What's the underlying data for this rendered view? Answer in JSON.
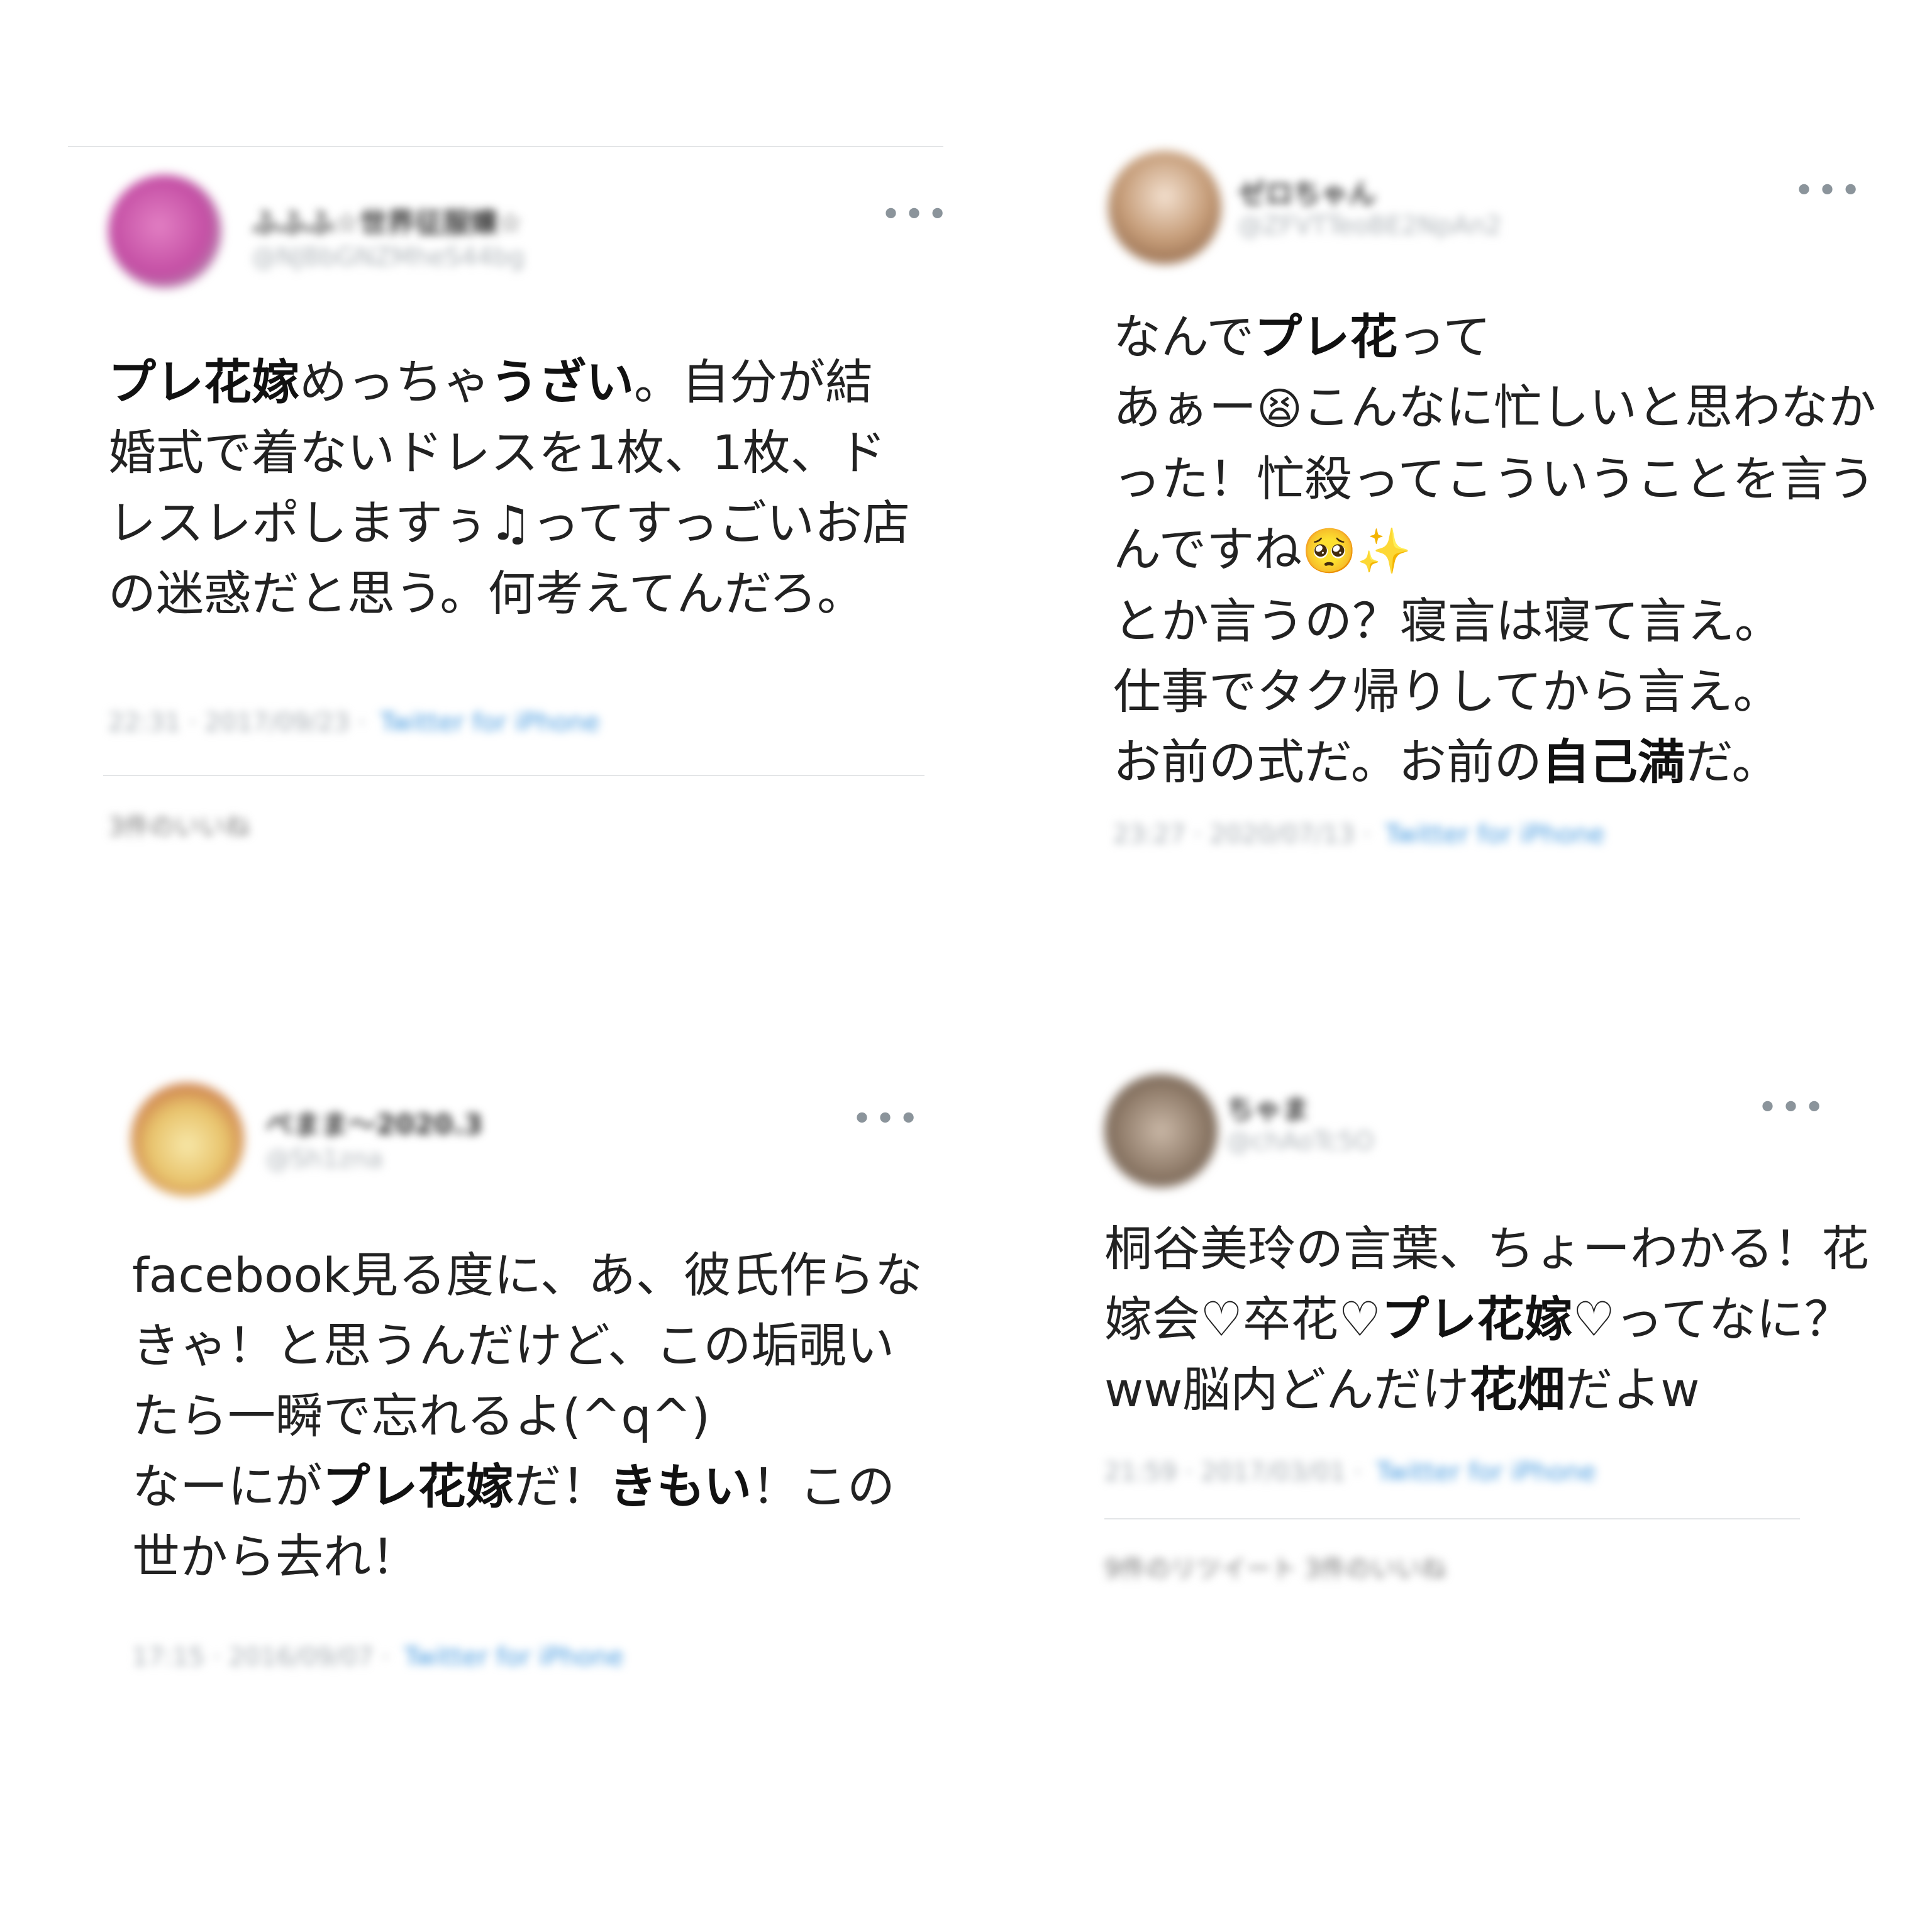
{
  "tweets": [
    {
      "name": "ふふふ☆世界征服嬢☆",
      "handle": "@NJBbGNZMheS44bg",
      "lines": [
        [
          {
            "t": "プレ花嫁",
            "b": true
          },
          {
            "t": "めっちゃ"
          },
          {
            "t": "うざい",
            "b": true
          },
          {
            "t": "。自分が結"
          }
        ],
        [
          {
            "t": "婚式で着ないドレスを1枚、1枚、ド"
          }
        ],
        [
          {
            "t": "レスレポしますぅ♫ってすっごいお店"
          }
        ],
        [
          {
            "t": "の迷惑だと思う。何考えてんだろ。"
          }
        ]
      ],
      "time": "22:31 · 2017/09/23 · ",
      "source": "Twitter for iPhone",
      "stats": "3件のいいね"
    },
    {
      "name": "ゼロちゃん",
      "handle": "@ZFVTTeoBE2NpAn2",
      "lines": [
        [
          {
            "t": "なんで"
          },
          {
            "t": "プレ花",
            "b": true
          },
          {
            "t": "って"
          }
        ],
        [
          {
            "t": "あぁー"
          },
          {
            "t": "😫",
            "e": true
          },
          {
            "t": "こんなに忙しいと思わなか"
          }
        ],
        [
          {
            "t": "った！忙殺ってこういうことを言う"
          }
        ],
        [
          {
            "t": "んですね"
          },
          {
            "t": "🥺",
            "e": true
          },
          {
            "t": "✨",
            "e": true
          }
        ],
        [
          {
            "t": "とか言うの？寝言は寝て言え。"
          }
        ],
        [
          {
            "t": "仕事でタク帰りしてから言え。"
          }
        ],
        [
          {
            "t": "お前の式だ。お前の"
          },
          {
            "t": "自己満",
            "b": true
          },
          {
            "t": "だ。"
          }
        ]
      ],
      "time": "23:27 · 2020/07/13 · ",
      "source": "Twitter for iPhone",
      "stats": ""
    },
    {
      "name": "ぺまま〜2020.3",
      "handle": "@Sh1zna",
      "lines": [
        [
          {
            "t": "facebook見る度に、あ、彼氏作らな"
          }
        ],
        [
          {
            "t": "きゃ！と思うんだけど、この垢覗い"
          }
        ],
        [
          {
            "t": "たら一瞬で忘れるよ(^q^)"
          }
        ],
        [
          {
            "t": "なーにが"
          },
          {
            "t": "プレ花嫁",
            "b": true
          },
          {
            "t": "だ！"
          },
          {
            "t": "きもい",
            "b": true
          },
          {
            "t": "！この"
          }
        ],
        [
          {
            "t": "世から去れ！"
          }
        ]
      ],
      "time": "17:15 · 2016/09/07 · ",
      "source": "Twitter for iPhone",
      "stats": ""
    },
    {
      "name": "ちゃま",
      "handle": "@chAoTc5O",
      "lines": [
        [
          {
            "t": "桐谷美玲の言葉、ちょーわかる！花"
          }
        ],
        [
          {
            "t": "嫁会♡卒花♡"
          },
          {
            "t": "プレ花嫁",
            "b": true
          },
          {
            "t": "♡ってなに？"
          }
        ],
        [
          {
            "t": "ww脳内どんだけ"
          },
          {
            "t": "花畑",
            "b": true
          },
          {
            "t": "だよw"
          }
        ]
      ],
      "time": "21:59 · 2017/03/01 · ",
      "source": "Twitter for iPhone",
      "stats": "9件のリツイート  3件のいいね"
    }
  ],
  "more_glyph": "•••",
  "colors": {
    "link": "#4a9ce0",
    "muted": "#a6adb3",
    "divider": "#e3e5e7"
  }
}
